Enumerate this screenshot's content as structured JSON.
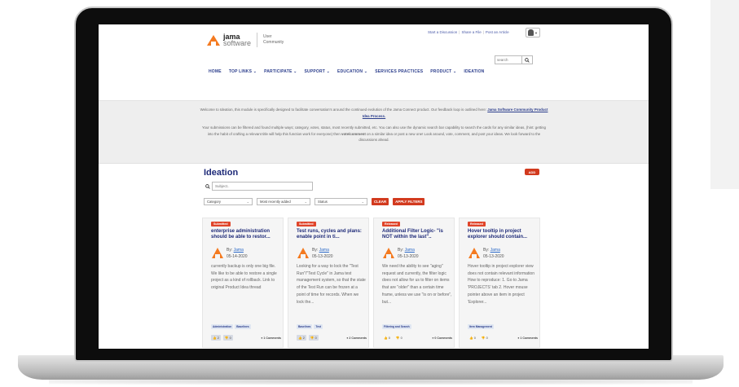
{
  "header": {
    "util_links": [
      "Start a Discussion",
      "Share a File",
      "Post an Article"
    ],
    "logo_line1": "jama",
    "logo_line2": "software",
    "logo_sub1": "User",
    "logo_sub2": "Community",
    "search_placeholder": "search"
  },
  "nav": {
    "items": [
      "HOME",
      "TOP LINKS ⌄",
      "PARTICIPATE ⌄",
      "SUPPORT ⌄",
      "EDUCATION ⌄",
      "SERVICES PRACTICES",
      "PRODUCT ⌄",
      "IDEATION"
    ]
  },
  "intro": {
    "p1_text": "Welcome to Ideation, this module is specifically designed to facilitate conversation's around the continued evolution of the Jama Connect product. Our feedback loop is outlined here: ",
    "p1_link": "Jama Software Community Product Idea Process.",
    "p2_a": "Your submissions can be filtered and found multiple ways; category, votes, status, most recently submitted, etc. You can also use the dynamic search bar capability to search the cards for any similar ideas, (hint: getting into the habit of crafting a relevant title will help this function work for everyone) then ",
    "p2_bold": "vote/comment",
    "p2_b": " on a similar idea or post a new one! Look around, vote, comment, and post your ideas. We look forward to the discussions ahead."
  },
  "ideation": {
    "title": "Ideation",
    "add_label": "ADD",
    "subject_placeholder": "Subject..",
    "filters": {
      "category": "Category",
      "sort": "Most recently added",
      "status": "Status",
      "clear": "CLEAR",
      "apply": "APPLY FILTERS"
    }
  },
  "cards": [
    {
      "status": "Submitted",
      "title": "enterprise administration should be able to restor...",
      "by_label": "By",
      "author": "Jama",
      "date": "05-14-2020",
      "body": "currently backup is only one big file. We like to be able to restore a single project as a kind of rollback. Link to original Product Idea thread",
      "tags": [
        "Administration",
        "Baselines"
      ],
      "likes": "2",
      "dislikes": "0",
      "comments": "1 Comments"
    },
    {
      "status": "Submitted",
      "title": "Test runs, cycles and plans: enable point in ti...",
      "by_label": "By",
      "author": "Jama",
      "date": "05-13-2020",
      "body": "Looking for a way to lock the \"Test Run\"/\"Test Cycle\" in Jama test management system, so that the state of the Test Run can be frozen at a point of time for records. When we lock the...",
      "tags": [
        "Baselines",
        "Test"
      ],
      "likes": "2",
      "dislikes": "0",
      "comments": "2 Comments"
    },
    {
      "status": "Released",
      "title": "Additional Filter Logic- \"is NOT within the last\"..",
      "by_label": "By",
      "author": "Jama",
      "date": "05-13-2020",
      "body": "We need the ability to see \"aging\" request and currently, the filter logic does not allow for us to filter on items that are \"older\" than a certain time frame, unless we use \"is on or before\", but...",
      "tags": [
        "Filtering and Search"
      ],
      "likes": "0",
      "dislikes": "0",
      "comments": "0 Comments"
    },
    {
      "status": "Released",
      "title": "Hover tooltip in project explorer should contain...",
      "by_label": "By",
      "author": "Jama",
      "date": "05-13-2020",
      "body": "Hover tooltip in project explorer view does not contain relevant information How to reproduce: 1. Go to Jama 'PROJECTS' tab 2. Hover mouse pointer above an item in project 'Explorer...",
      "tags": [
        "Item Management"
      ],
      "likes": "0",
      "dislikes": "0",
      "comments": "1 Comments"
    }
  ],
  "colors": {
    "brand_orange": "#f47a20",
    "nav_blue": "#2c3e8c",
    "title_blue": "#1e2a78",
    "action_red": "#d23a1e"
  }
}
